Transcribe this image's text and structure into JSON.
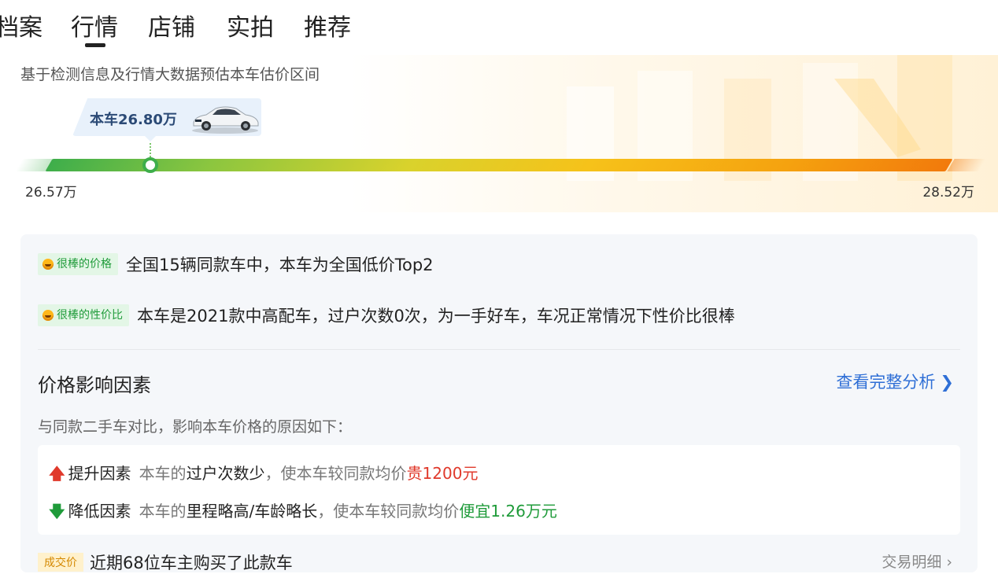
{
  "tabs": [
    {
      "label": "档案"
    },
    {
      "label": "行情"
    },
    {
      "label": "店铺"
    },
    {
      "label": "实拍"
    },
    {
      "label": "推荐"
    }
  ],
  "estimate": {
    "title": "基于检测信息及行情大数据预估本车估价区间",
    "car_price_label": "本车26.80万",
    "range_min": "26.57万",
    "range_max": "28.52万"
  },
  "highlights": [
    {
      "tag": "很棒的价格",
      "text": "全国15辆同款车中，本车为全国低价Top2"
    },
    {
      "tag": "很棒的性价比",
      "text": "本车是2021款中高配车，过户次数0次，为一手好车，车况正常情况下性价比很棒"
    }
  ],
  "factors": {
    "title": "价格影响因素",
    "link": "查看完整分析",
    "subtitle": "与同款二手车对比，影响本车价格的原因如下：",
    "up": {
      "label": "提升因素",
      "pre": "本车的",
      "key": "过户次数少",
      "mid": "，使本车较同款均价",
      "value": "贵1200元"
    },
    "down": {
      "label": "降低因素",
      "pre": "本车的",
      "key": "里程略高/车龄略长",
      "mid": "，使本车较同款均价",
      "value": "便宜1.26万元"
    }
  },
  "bottom": {
    "tag": "成交价",
    "text": "近期68位车主购买了此款车",
    "link": "交易明细 ›"
  },
  "colors": {
    "accent_blue": "#2f6fd6",
    "up_red": "#e0392b",
    "down_green": "#1f9b3a"
  }
}
